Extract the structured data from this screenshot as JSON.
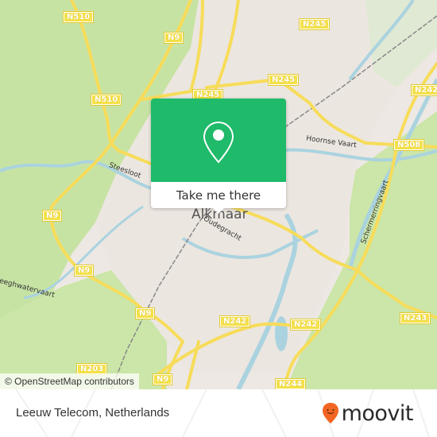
{
  "map": {
    "city": "Alkmaar",
    "road_labels": [
      {
        "id": "n510-top",
        "text": "N510"
      },
      {
        "id": "n9-top",
        "text": "N9"
      },
      {
        "id": "n245-top",
        "text": "N245"
      },
      {
        "id": "n245-mid",
        "text": "N245"
      },
      {
        "id": "n245-left",
        "text": "N245"
      },
      {
        "id": "n510-mid",
        "text": "N510"
      },
      {
        "id": "n242-top",
        "text": "N242"
      },
      {
        "id": "n508",
        "text": "N508"
      },
      {
        "id": "n9-left",
        "text": "N9"
      },
      {
        "id": "n9-mid",
        "text": "N9"
      },
      {
        "id": "n9-bottom",
        "text": "N9"
      },
      {
        "id": "n242-bottom",
        "text": "N242"
      },
      {
        "id": "n242-mid",
        "text": "N242"
      },
      {
        "id": "n243",
        "text": "N243"
      },
      {
        "id": "n203",
        "text": "N203"
      },
      {
        "id": "n9-lower",
        "text": "N9"
      },
      {
        "id": "n244",
        "text": "N244"
      }
    ],
    "street_labels": {
      "steesloot": "Steesloot",
      "hoornse_vaart": "Hoornse Vaart",
      "oudegracht": "Oudegracht",
      "schermerringvaart": "Schermerringvaart",
      "leeghwatervaart": "eeghwatervaart"
    },
    "attribution": "© OpenStreetMap contributors"
  },
  "popup": {
    "icon": "map-pin-icon",
    "button_label": "Take me there",
    "color": "#1fba6a"
  },
  "footer": {
    "place_name": "Leeuw Telecom, Netherlands",
    "brand": "moovit",
    "brand_color": "#f26522"
  }
}
